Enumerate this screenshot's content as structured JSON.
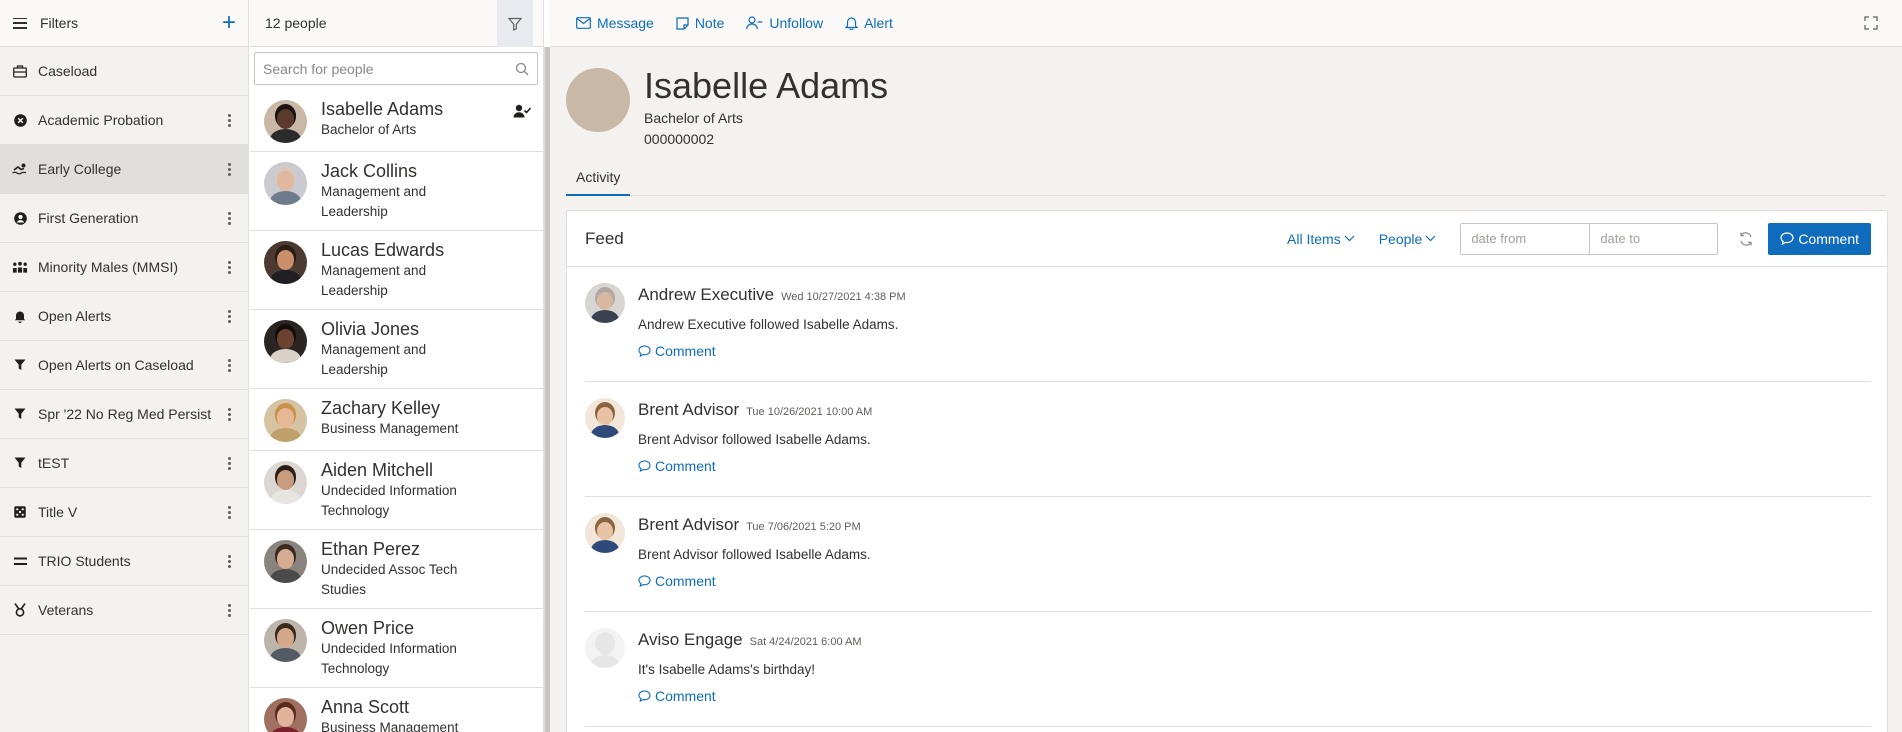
{
  "sidebar": {
    "title": "Filters",
    "add_label": "+",
    "items": [
      {
        "label": "Caseload",
        "icon": "briefcase-icon",
        "kebab": false
      },
      {
        "label": "Academic Probation",
        "icon": "close-circle-icon",
        "kebab": true
      },
      {
        "label": "Early College",
        "icon": "swimmer-icon",
        "kebab": true,
        "active": true
      },
      {
        "label": "First Generation",
        "icon": "user-circle-icon",
        "kebab": true
      },
      {
        "label": "Minority Males (MMSI)",
        "icon": "people-group-icon",
        "kebab": true
      },
      {
        "label": "Open Alerts",
        "icon": "bell-icon",
        "kebab": true
      },
      {
        "label": "Open Alerts on Caseload",
        "icon": "filter-icon",
        "kebab": true
      },
      {
        "label": "Spr '22 No Reg Med Persist",
        "icon": "filter-icon",
        "kebab": true
      },
      {
        "label": "tEST",
        "icon": "filter-icon",
        "kebab": true
      },
      {
        "label": "Title V",
        "icon": "dice-icon",
        "kebab": true
      },
      {
        "label": "TRIO Students",
        "icon": "equals-icon",
        "kebab": true
      },
      {
        "label": "Veterans",
        "icon": "medal-icon",
        "kebab": true
      }
    ]
  },
  "people_list": {
    "count_label": "12 people",
    "search_placeholder": "Search for people",
    "people": [
      {
        "name": "Isabelle Adams",
        "program": "Bachelor of Arts",
        "skin": "#5a3a2a",
        "hair": "#1a1210",
        "shirt": "#2b2b2b",
        "bg": "#c9b8a6"
      },
      {
        "name": "Jack Collins",
        "program": "Management and Leadership",
        "skin": "#e0b8a0",
        "hair": "#d7c8bd",
        "shirt": "#6d7b8c",
        "bg": "#c9cbd0"
      },
      {
        "name": "Lucas Edwards",
        "program": "Management and Leadership",
        "skin": "#c98f6d",
        "hair": "#2b1c14",
        "shirt": "#1f1f24",
        "bg": "#4a3a32"
      },
      {
        "name": "Olivia Jones",
        "program": "Management and Leadership",
        "skin": "#6b4230",
        "hair": "#120c0a",
        "shirt": "#d9d2c8",
        "bg": "#2a2422"
      },
      {
        "name": "Zachary Kelley",
        "program": "Business Management",
        "skin": "#e7b896",
        "hair": "#c9924a",
        "shirt": "#bfa06a",
        "bg": "#d6c3a4"
      },
      {
        "name": "Aiden Mitchell",
        "program": "Undecided Information Technology",
        "skin": "#c99c7e",
        "hair": "#2a1d16",
        "shirt": "#e8e4e0",
        "bg": "#dcd7d2"
      },
      {
        "name": "Ethan Perez",
        "program": "Undecided Assoc Tech Studies",
        "skin": "#d6ad92",
        "hair": "#3a2a20",
        "shirt": "#4a4a4a",
        "bg": "#8a847e"
      },
      {
        "name": "Owen Price",
        "program": "Undecided Information Technology",
        "skin": "#d4a78a",
        "hair": "#3a2a1e",
        "shirt": "#555b64",
        "bg": "#bdb4aa"
      },
      {
        "name": "Anna Scott",
        "program": "Business Management Technology",
        "skin": "#e2b39a",
        "hair": "#5a2a1c",
        "shirt": "#7a1f2b",
        "bg": "#a07060"
      }
    ]
  },
  "toolbar": {
    "message": "Message",
    "note": "Note",
    "unfollow": "Unfollow",
    "alert": "Alert"
  },
  "profile": {
    "name": "Isabelle Adams",
    "program": "Bachelor of Arts",
    "id": "000000002"
  },
  "tabs": [
    {
      "label": "Activity"
    }
  ],
  "feed": {
    "title": "Feed",
    "all_items": "All Items",
    "people": "People",
    "date_from_placeholder": "date from",
    "date_to_placeholder": "date to",
    "comment_button": "Comment",
    "entries": [
      {
        "name": "Andrew Executive",
        "time": "Wed 10/27/2021 4:38 PM",
        "text": "Andrew Executive followed Isabelle Adams.",
        "comment": "Comment",
        "skin": "#d9b8a2",
        "hair": "#b0a8a2",
        "shirt": "#3a4250",
        "bg": "#d8d6d2"
      },
      {
        "name": "Brent Advisor",
        "time": "Tue 10/26/2021 10:00 AM",
        "text": "Brent Advisor followed Isabelle Adams.",
        "comment": "Comment",
        "skin": "#e8c2a4",
        "hair": "#8a6440",
        "shirt": "#2e4a7a",
        "bg": "#f2e6d8"
      },
      {
        "name": "Brent Advisor",
        "time": "Tue 7/06/2021 5:20 PM",
        "text": "Brent Advisor followed Isabelle Adams.",
        "comment": "Comment",
        "skin": "#e8c2a4",
        "hair": "#8a6440",
        "shirt": "#2e4a7a",
        "bg": "#f2e6d8"
      },
      {
        "name": "Aviso Engage",
        "time": "Sat 4/24/2021 6:00 AM",
        "text": "It's Isabelle Adams's birthday!",
        "comment": "Comment",
        "skin": "#e6e6e6",
        "hair": "#e6e6e6",
        "shirt": "#e6e6e6",
        "bg": "#f3f3f3"
      }
    ]
  },
  "colors": {
    "accent": "#0f6cbd",
    "active_row": "#e1dfdd"
  }
}
